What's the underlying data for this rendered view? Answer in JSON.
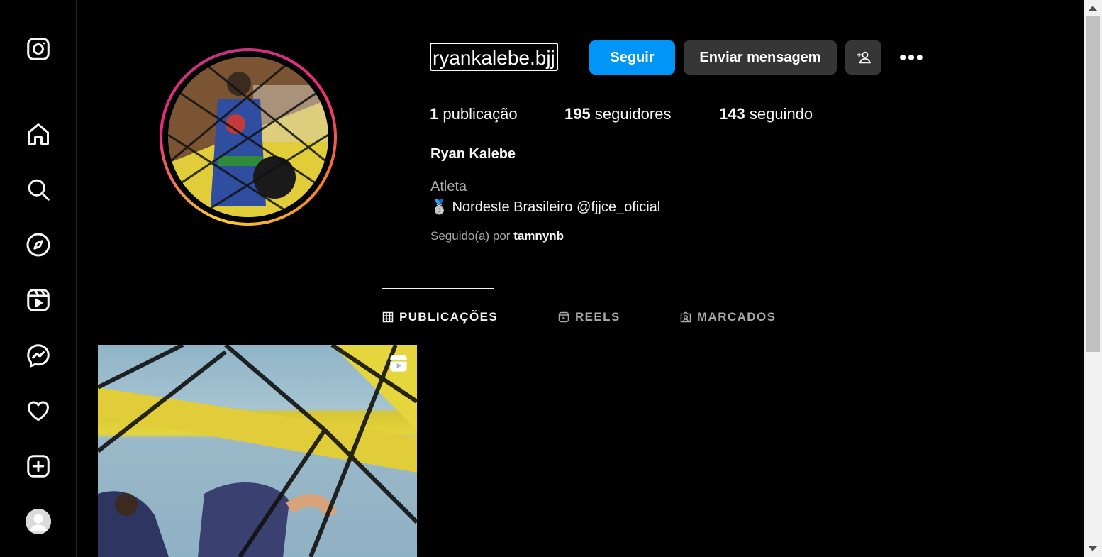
{
  "nav": {
    "items": [
      "instagram-logo",
      "home",
      "search",
      "explore",
      "reels",
      "messenger",
      "notifications",
      "create",
      "profile"
    ]
  },
  "profile": {
    "username": "ryankalebe.bjj",
    "follow_label": "Seguir",
    "message_label": "Enviar mensagem",
    "more_label": "•••",
    "stats": {
      "posts_count": "1",
      "posts_label": "publicação",
      "followers_count": "195",
      "followers_label": "seguidores",
      "following_count": "143",
      "following_label": "seguindo"
    },
    "full_name": "Ryan Kalebe",
    "category": "Atleta",
    "bio_emoji": "🥈",
    "bio_text": "Nordeste Brasileiro @fjjce_oficial",
    "followed_by_prefix": "Seguido(a) por",
    "followed_by_user": "tamnynb"
  },
  "tabs": [
    {
      "label": "PUBLICAÇÕES",
      "active": true
    },
    {
      "label": "REELS",
      "active": false
    },
    {
      "label": "MARCADOS",
      "active": false
    }
  ],
  "colors": {
    "follow_button": "#0095f6",
    "secondary_button": "#363636",
    "background": "#000000"
  }
}
